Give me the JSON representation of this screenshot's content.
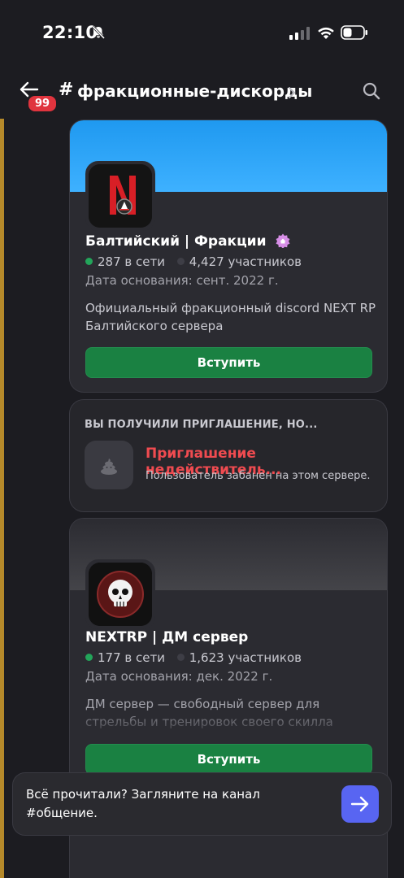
{
  "status_bar": {
    "time": "22:10"
  },
  "header": {
    "hash": "#",
    "channel": "фракционные-дискорды",
    "badge": "99"
  },
  "cards": [
    {
      "name": "Балтийский | Фракции",
      "online": "287 в сети",
      "members": "4,427 участников",
      "founded": "Дата основания: сент. 2022 г.",
      "description": "Официальный фракционный discord NEXT RP Балтийского сервера",
      "join_label": "Вступить"
    },
    {
      "heading": "ВЫ ПОЛУЧИЛИ ПРИГЛАШЕНИЕ, НО...",
      "title": "Приглашение недействитель...",
      "subtitle": "Пользователь забанен на этом сервере."
    },
    {
      "name": "NEXTRP | ДМ сервер",
      "online": "177 в сети",
      "members": "1,623 участников",
      "founded": "Дата основания: дек. 2022 г.",
      "description": "ДМ сервер — свободный сервер для стрельбы и тренировок своего скилла",
      "join_label": "Вступить"
    }
  ],
  "toast": {
    "text": "Всё прочитали? Загляните на канал #общение."
  },
  "colors": {
    "accent": "#5865f2",
    "join": "#1a8142",
    "error": "#f04b50",
    "online": "#23a55a"
  }
}
